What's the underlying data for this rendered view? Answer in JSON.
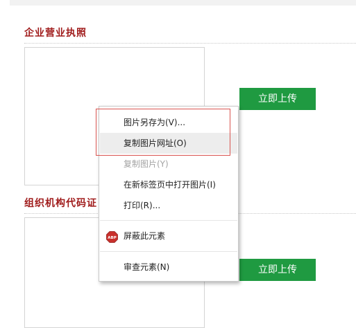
{
  "sections": {
    "business_license": {
      "title": "企业营业执照",
      "upload_label": "立即上传"
    },
    "org_code": {
      "title": "组织机构代码证",
      "upload_label": "立即上传"
    }
  },
  "context_menu": {
    "items": [
      {
        "label": "图片另存为(V)...",
        "state": "normal"
      },
      {
        "label": "复制图片网址(O)",
        "state": "hover"
      },
      {
        "label": "复制图片(Y)",
        "state": "disabled"
      },
      {
        "label": "在新标签页中打开图片(I)",
        "state": "normal"
      },
      {
        "label": "打印(R)...",
        "state": "normal"
      },
      {
        "label": "屏蔽此元素",
        "state": "normal",
        "icon": "adblock-plus-icon",
        "icon_text": "ABP"
      },
      {
        "label": "审查元素(N)",
        "state": "normal"
      }
    ]
  },
  "colors": {
    "title_red": "#a01c1c",
    "upload_green": "#1f9a41",
    "highlight_red": "#d9534f",
    "abp_red": "#c9302c"
  }
}
